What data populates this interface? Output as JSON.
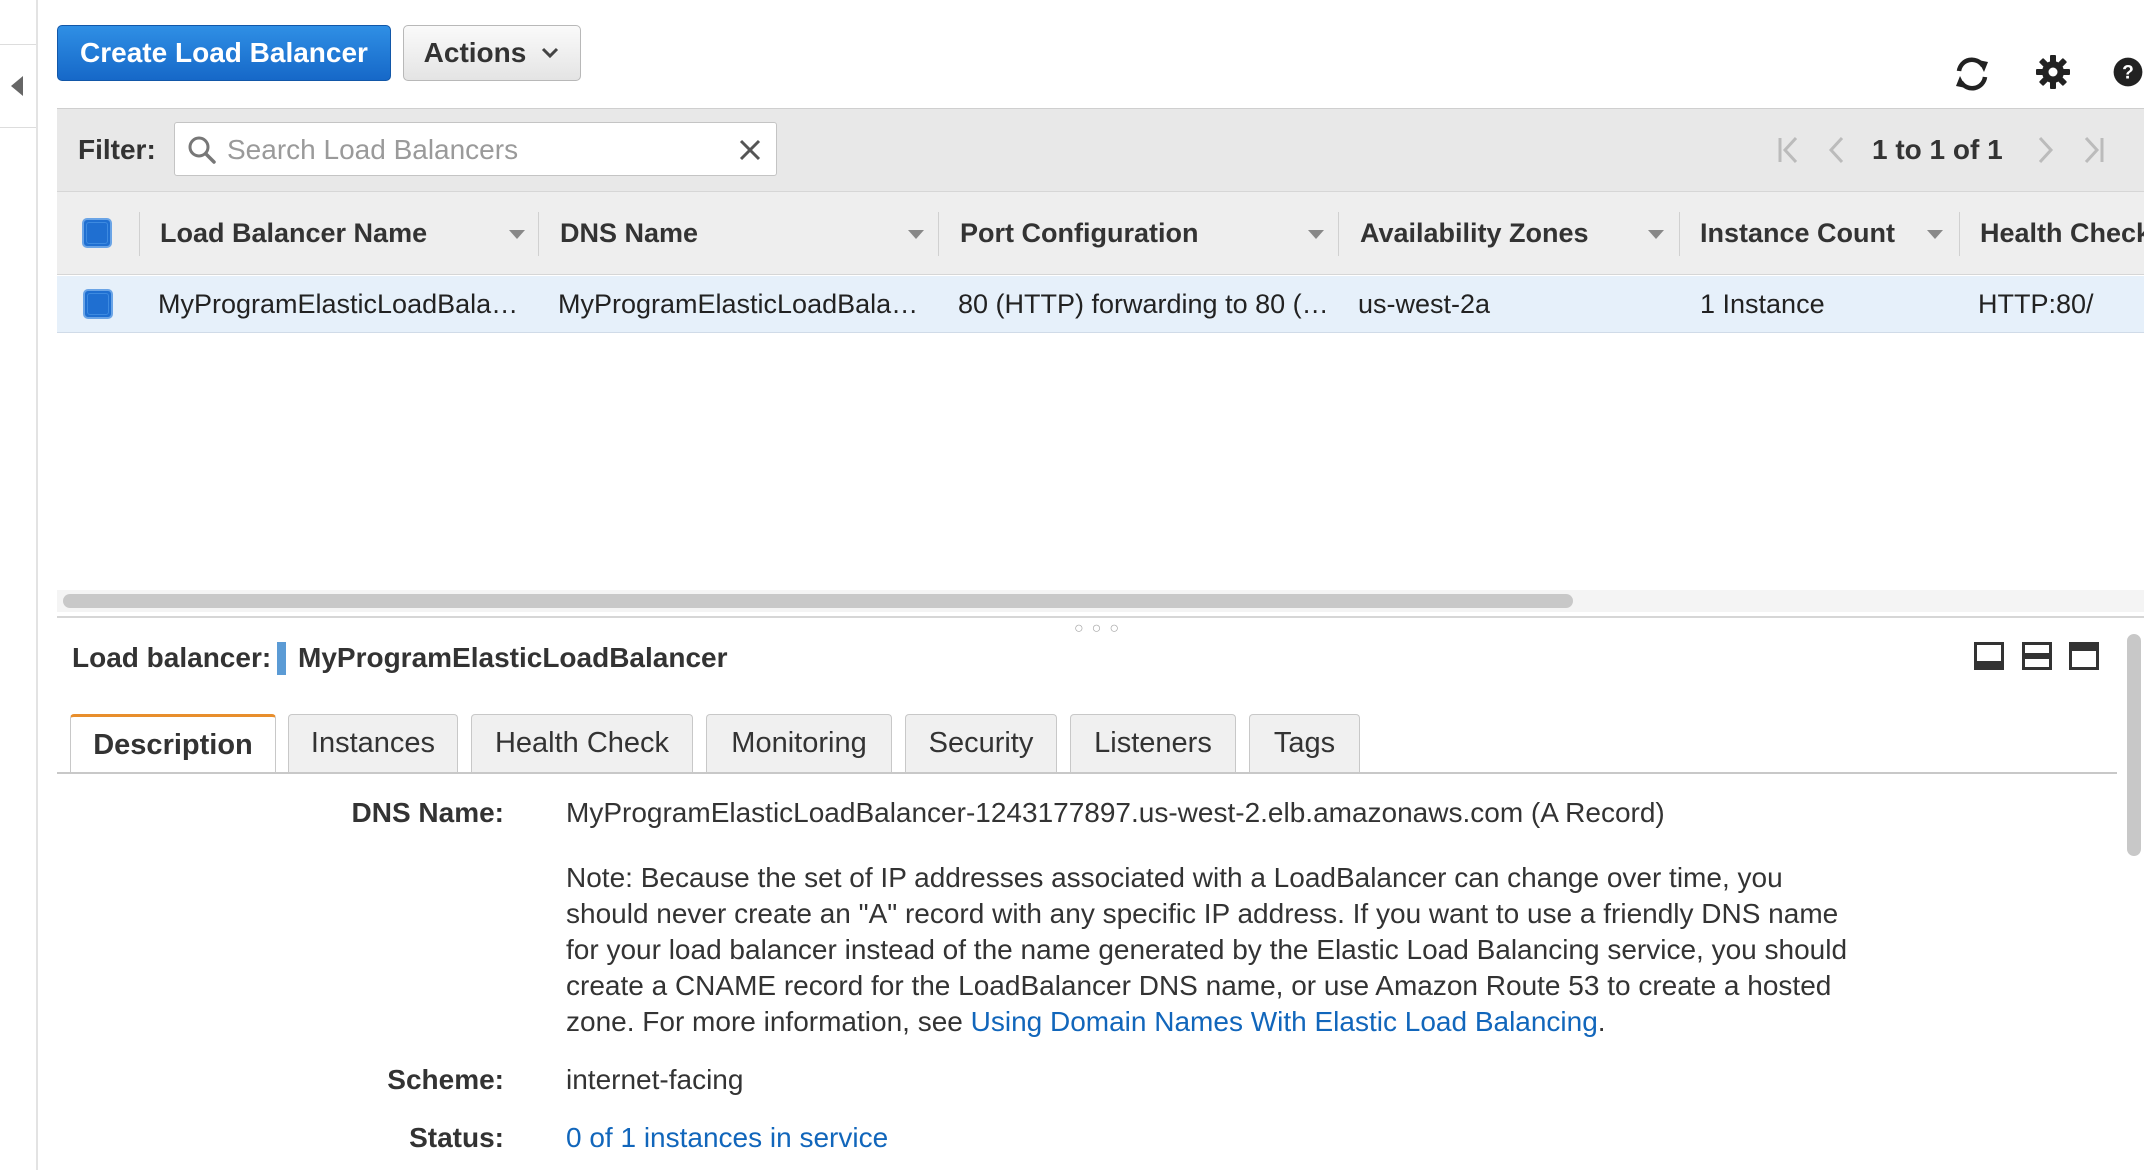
{
  "toolbar": {
    "create_label": "Create Load Balancer",
    "actions_label": "Actions"
  },
  "filter": {
    "label": "Filter:",
    "search_placeholder": "Search Load Balancers",
    "pager": "1 to 1 of 1"
  },
  "table": {
    "columns": [
      "Load Balancer Name",
      "DNS Name",
      "Port Configuration",
      "Availability Zones",
      "Instance Count",
      "Health Check"
    ],
    "rows": [
      {
        "name": "MyProgramElasticLoadBala…",
        "dns": "MyProgramElasticLoadBala…",
        "port": "80 (HTTP) forwarding to 80 (…",
        "zones": "us-west-2a",
        "count": "1 Instance",
        "health": "HTTP:80/"
      }
    ]
  },
  "details": {
    "label": "Load balancer:",
    "name": "MyProgramElasticLoadBalancer",
    "tabs": [
      "Description",
      "Instances",
      "Health Check",
      "Monitoring",
      "Security",
      "Listeners",
      "Tags"
    ],
    "dns_label": "DNS Name:",
    "dns_value": "MyProgramElasticLoadBalancer-1243177897.us-west-2.elb.amazonaws.com (A Record)",
    "note_text": "Note: Because the set of IP addresses associated with a LoadBalancer can change over time, you should never create an \"A\" record with any specific IP address. If you want to use a friendly DNS name for your load balancer instead of the name generated by the Elastic Load Balancing service, you should create a CNAME record for the LoadBalancer DNS name, or use Amazon Route 53 to create a hosted zone. For more information, see",
    "note_link": "Using Domain Names With Elastic Load Balancing",
    "note_end": ".",
    "scheme_label": "Scheme:",
    "scheme_value": "internet-facing",
    "status_label": "Status:",
    "status_value": "0 of 1 instances in service"
  },
  "colors": {
    "primary_button": "#1f6fd1",
    "active_tab_accent": "#e88e2c",
    "link": "#1166bb",
    "selected_row": "#e6f0fa"
  }
}
